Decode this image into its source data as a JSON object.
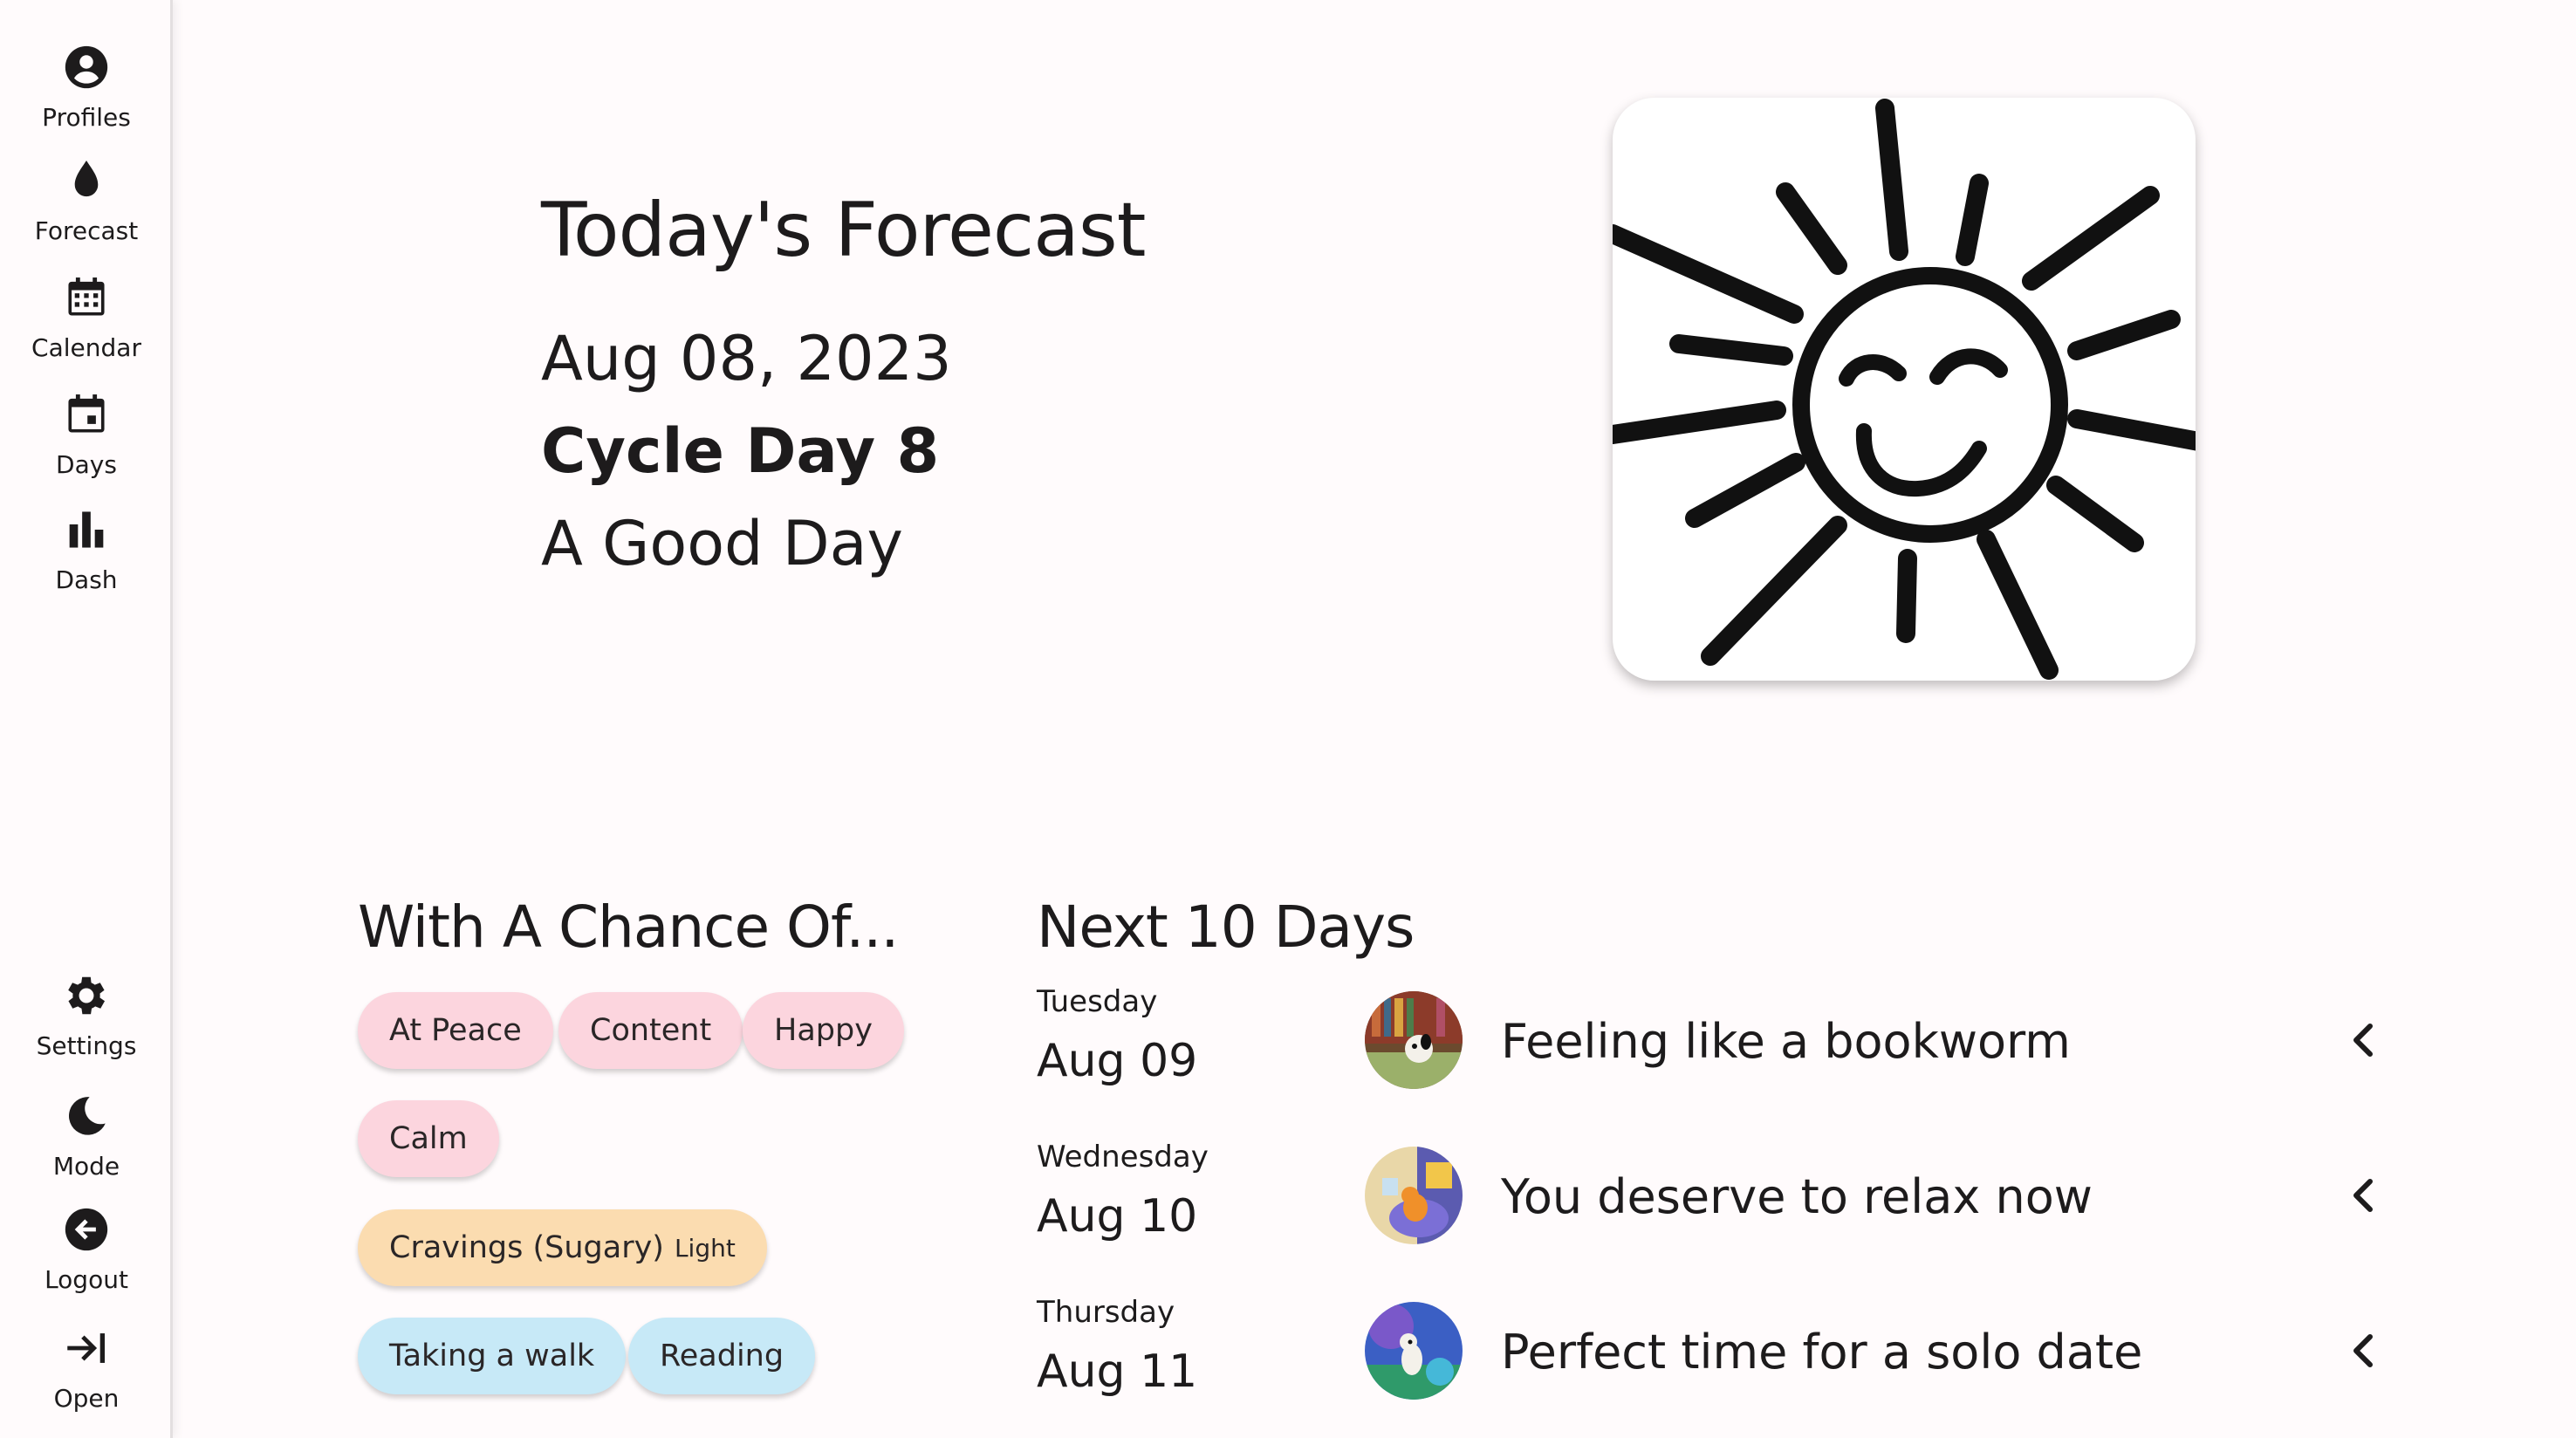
{
  "sidebar": {
    "top_items": [
      {
        "label": "Profiles",
        "icon": "account-circle-icon"
      },
      {
        "label": "Forecast",
        "icon": "drop-icon"
      },
      {
        "label": "Calendar",
        "icon": "calendar-icon"
      },
      {
        "label": "Days",
        "icon": "calendar-day-icon"
      },
      {
        "label": "Dash",
        "icon": "bar-chart-icon"
      }
    ],
    "bottom_items": [
      {
        "label": "Settings",
        "icon": "gear-icon"
      },
      {
        "label": "Mode",
        "icon": "moon-icon"
      },
      {
        "label": "Logout",
        "icon": "logout-arrow-icon"
      },
      {
        "label": "Open",
        "icon": "open-arrow-icon"
      }
    ]
  },
  "forecast": {
    "title": "Today's Forecast",
    "date": "Aug 08, 2023",
    "cycle_day": "Cycle Day 8",
    "day_type": "A Good Day",
    "image_icon": "smiling-sun-icon"
  },
  "chance": {
    "title": "With A Chance Of...",
    "moods": [
      "At Peace",
      "Content",
      "Happy",
      "Calm"
    ],
    "symptom": {
      "label": "Cravings (Sugary)",
      "level": "Light"
    },
    "activities": [
      "Taking a walk",
      "Reading"
    ]
  },
  "next_days": {
    "title": "Next 10 Days",
    "days": [
      {
        "weekday": "Tuesday",
        "date": "Aug 09",
        "message": "Feeling like a bookworm",
        "avatar": "bookworm-avatar"
      },
      {
        "weekday": "Wednesday",
        "date": "Aug 10",
        "message": "You deserve to relax now",
        "avatar": "relax-avatar"
      },
      {
        "weekday": "Thursday",
        "date": "Aug 11",
        "message": "Perfect time for a solo date",
        "avatar": "solo-date-avatar"
      }
    ]
  },
  "colors": {
    "mood_chip": "#fcd5de",
    "symptom_chip": "#fbdcb0",
    "activity_chip": "#c7e9f7",
    "background": "#fffbfc"
  }
}
